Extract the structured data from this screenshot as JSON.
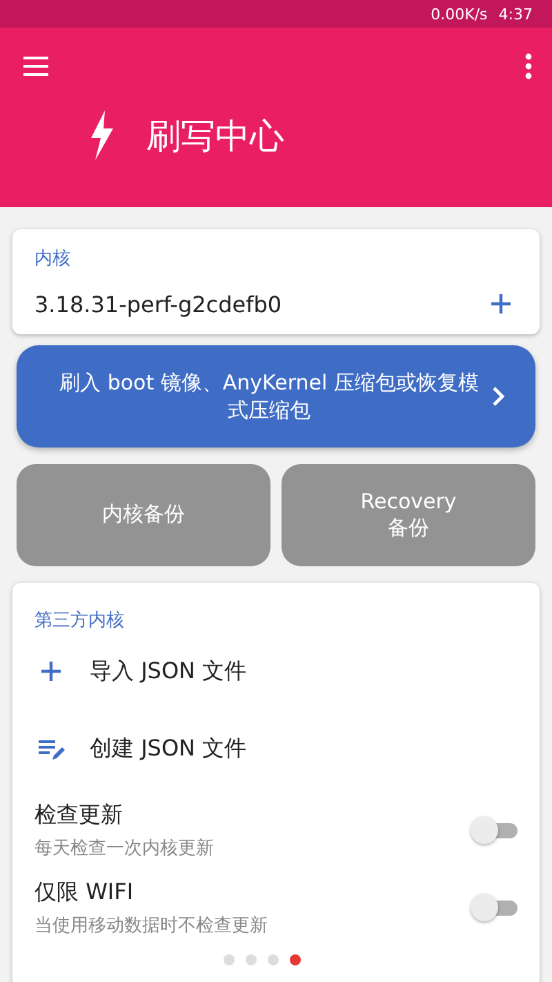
{
  "status_bar": {
    "speed": "0.00K/s",
    "time": "4:37"
  },
  "toolbar": {
    "title": "刷写中心"
  },
  "kernel_card": {
    "heading": "内核",
    "version": "3.18.31-perf-g2cdefb0"
  },
  "flash_button": {
    "label": "刷入 boot 镜像、AnyKernel 压缩包或恢复模式压缩包"
  },
  "backup_buttons": [
    {
      "label": "内核备份"
    },
    {
      "label": "Recovery\n备份"
    }
  ],
  "third_party_card": {
    "heading": "第三方内核",
    "actions": [
      {
        "kind": "add",
        "label": "导入 JSON 文件"
      },
      {
        "kind": "edit",
        "label": "创建 JSON 文件"
      }
    ],
    "settings": [
      {
        "title": "检查更新",
        "subtitle": "每天检查一次内核更新",
        "on": false
      },
      {
        "title": "仅限 WIFI",
        "subtitle": "当使用移动数据时不检查更新",
        "on": false
      }
    ]
  },
  "pager": [
    {
      "selected": false
    },
    {
      "selected": false
    },
    {
      "selected": false
    },
    {
      "selected": true
    }
  ]
}
